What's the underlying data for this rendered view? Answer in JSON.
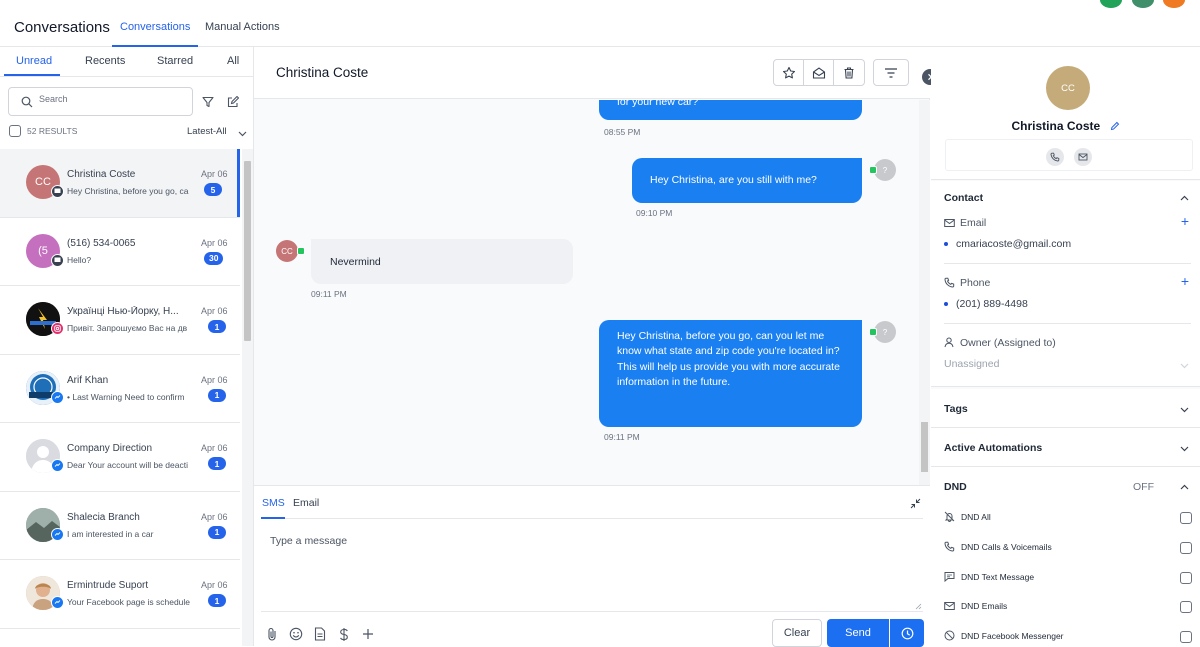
{
  "topbar": {
    "title": "Conversations",
    "tabs": [
      {
        "label": "Conversations",
        "active": true
      },
      {
        "label": "Manual Actions",
        "active": false
      }
    ]
  },
  "left": {
    "tabs": [
      {
        "label": "Unread",
        "active": true
      },
      {
        "label": "Recents",
        "active": false
      },
      {
        "label": "Starred",
        "active": false
      },
      {
        "label": "All",
        "active": false
      }
    ],
    "search_placeholder": "Search",
    "results": "52 RESULTS",
    "sort": "Latest-All",
    "conversations": [
      {
        "name": "Christina Coste",
        "snippet": "Hey Christina, before you go, ca",
        "date": "Apr 06",
        "badge": "5",
        "initials": "CC",
        "avatar_color": "#c57575",
        "channel": "sms",
        "selected": true
      },
      {
        "name": "(516) 534-0065",
        "snippet": "Hello?",
        "date": "Apr 06",
        "badge": "30",
        "initials": "(5",
        "avatar_color": "#c56fbf",
        "channel": "sms",
        "selected": false
      },
      {
        "name": "Українці Нью-Йорку, Н...",
        "snippet": "Привіт. Запрошуємо Вас на дв",
        "date": "Apr 06",
        "badge": "1",
        "initials": "",
        "avatar_color": "#1a1a1a",
        "channel": "instagram",
        "selected": false
      },
      {
        "name": "Arif Khan",
        "snippet": "• Last Warning Need to confirm",
        "date": "Apr 06",
        "badge": "1",
        "initials": "",
        "avatar_color": "#1e6fb8",
        "channel": "messenger",
        "selected": false
      },
      {
        "name": "Company Direction",
        "snippet": "Dear Your account will be deacti",
        "date": "Apr 06",
        "badge": "1",
        "initials": "",
        "avatar_color": "#d9dbe0",
        "channel": "messenger",
        "selected": false
      },
      {
        "name": "Shalecia Branch",
        "snippet": "I am interested in a car",
        "date": "Apr 06",
        "badge": "1",
        "initials": "",
        "avatar_color": "#7a8c86",
        "channel": "messenger",
        "selected": false
      },
      {
        "name": "Ermintrude Suport",
        "snippet": "Your Facebook page is schedule",
        "date": "Apr 06",
        "badge": "1",
        "initials": "",
        "avatar_color": "#d9a98a",
        "channel": "messenger",
        "selected": false
      }
    ]
  },
  "chat": {
    "contact_name": "Christina Coste",
    "messages": [
      {
        "direction": "out",
        "text": "for your new car?",
        "time": "08:55 PM"
      },
      {
        "direction": "out",
        "text": "Hey Christina, are you still with me?",
        "time": "09:10 PM",
        "avatar": "?"
      },
      {
        "direction": "in",
        "text": "Nevermind",
        "time": "09:11 PM",
        "avatar": "CC"
      },
      {
        "direction": "out",
        "text": "Hey Christina, before you go, can you let me know what state and zip code you're located in? This will help us provide you with more accurate information in the future.",
        "time": "09:11 PM",
        "avatar": "?"
      }
    ],
    "composer": {
      "tabs": [
        {
          "label": "SMS",
          "active": true
        },
        {
          "label": "Email",
          "active": false
        }
      ],
      "placeholder": "Type a message",
      "clear_label": "Clear",
      "send_label": "Send"
    }
  },
  "contact": {
    "initials": "CC",
    "name": "Christina Coste",
    "contact_title": "Contact",
    "email_label": "Email",
    "email_value": "cmariacoste@gmail.com",
    "phone_label": "Phone",
    "phone_value": "(201) 889-4498",
    "owner_label": "Owner (Assigned to)",
    "owner_value": "Unassigned",
    "tags_title": "Tags",
    "automations_title": "Active Automations",
    "dnd_title": "DND",
    "dnd_status": "OFF",
    "dnd_items": [
      {
        "label": "DND All",
        "icon": "bell-off-icon"
      },
      {
        "label": "DND Calls & Voicemails",
        "icon": "phone-icon"
      },
      {
        "label": "DND Text Message",
        "icon": "message-icon"
      },
      {
        "label": "DND Emails",
        "icon": "mail-icon"
      },
      {
        "label": "DND Facebook Messenger",
        "icon": "block-icon"
      }
    ]
  },
  "colors": {
    "accent": "#2563eb",
    "bubble_out": "#1a7ff0",
    "bubble_in": "#f0f1f5",
    "avatar_contact": "#c4ab79"
  }
}
